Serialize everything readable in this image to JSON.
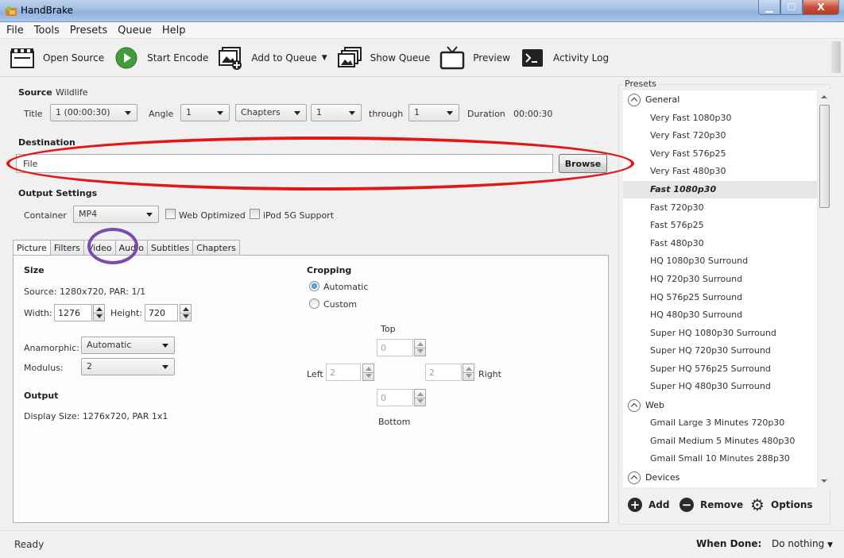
{
  "window": {
    "title": "HandBrake"
  },
  "menu": [
    "File",
    "Tools",
    "Presets",
    "Queue",
    "Help"
  ],
  "toolbar": {
    "open_source": "Open Source",
    "start_encode": "Start Encode",
    "add_to_queue": "Add to Queue",
    "show_queue": "Show Queue",
    "preview": "Preview",
    "activity_log": "Activity Log"
  },
  "source": {
    "label": "Source",
    "name": "Wildlife",
    "title_label": "Title",
    "title_value": "1 (00:00:30)",
    "angle_label": "Angle",
    "angle_value": "1",
    "range_mode": "Chapters",
    "range_start": "1",
    "through_label": "through",
    "range_end": "1",
    "duration_label": "Duration",
    "duration_value": "00:00:30"
  },
  "destination": {
    "label": "Destination",
    "file_label": "File",
    "file_value": "",
    "browse": "Browse"
  },
  "output_settings": {
    "label": "Output Settings",
    "container_label": "Container",
    "container_value": "MP4",
    "web_optimized": "Web Optimized",
    "ipod": "iPod 5G Support"
  },
  "tabs": [
    "Picture",
    "Filters",
    "Video",
    "Audio",
    "Subtitles",
    "Chapters"
  ],
  "picture": {
    "size_label": "Size",
    "source_info": "Source:  1280x720, PAR: 1/1",
    "width_label": "Width:",
    "width_value": "1276",
    "height_label": "Height:",
    "height_value": "720",
    "anamorphic_label": "Anamorphic:",
    "anamorphic_value": "Automatic",
    "modulus_label": "Modulus:",
    "modulus_value": "2",
    "output_label": "Output",
    "display_size": "Display Size: 1276x720,  PAR 1x1"
  },
  "cropping": {
    "label": "Cropping",
    "automatic": "Automatic",
    "custom": "Custom",
    "top_label": "Top",
    "top_value": "0",
    "left_label": "Left",
    "left_value": "2",
    "right_label": "Right",
    "right_value": "2",
    "bottom_label": "Bottom",
    "bottom_value": "0"
  },
  "presets": {
    "title": "Presets",
    "general_label": "General",
    "general": [
      "Very Fast 1080p30",
      "Very Fast 720p30",
      "Very Fast 576p25",
      "Very Fast 480p30",
      "Fast 1080p30",
      "Fast 720p30",
      "Fast 576p25",
      "Fast 480p30",
      "HQ 1080p30 Surround",
      "HQ 720p30 Surround",
      "HQ 576p25 Surround",
      "HQ 480p30 Surround",
      "Super HQ 1080p30 Surround",
      "Super HQ 720p30 Surround",
      "Super HQ 576p25 Surround",
      "Super HQ 480p30 Surround"
    ],
    "selected": "Fast 1080p30",
    "web_label": "Web",
    "web": [
      "Gmail Large 3 Minutes 720p30",
      "Gmail Medium 5 Minutes 480p30",
      "Gmail Small 10 Minutes 288p30"
    ],
    "devices_label": "Devices",
    "add": "Add",
    "remove": "Remove",
    "options": "Options"
  },
  "status": {
    "text": "Ready",
    "when_done_label": "When Done:",
    "when_done_value": "Do nothing"
  },
  "colors": {
    "annotation_red": "#e01818",
    "annotation_purple": "#7a4bb0",
    "selected_preset_bg": "#e6e6e6"
  }
}
